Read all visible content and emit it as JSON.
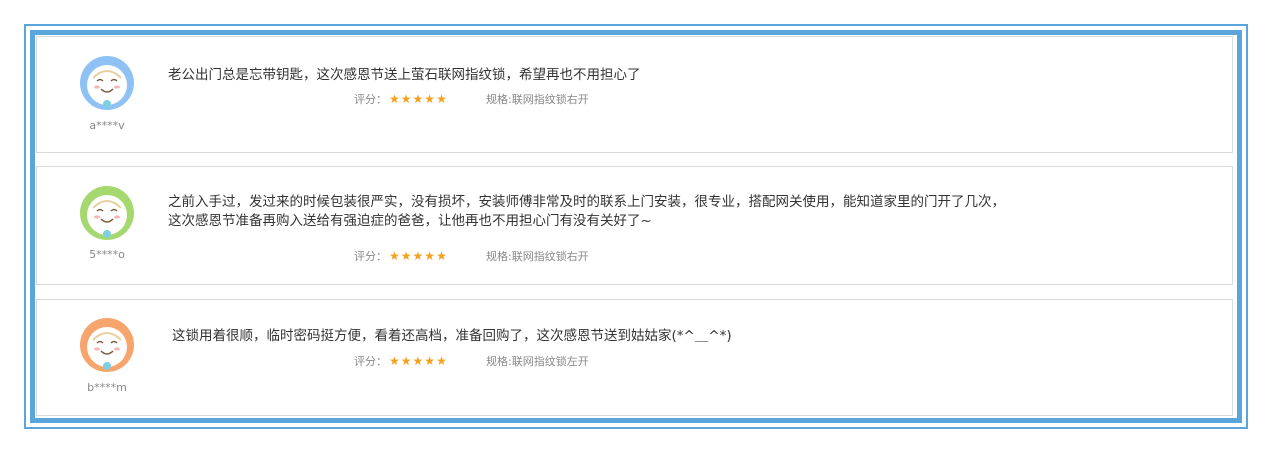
{
  "reviews": [
    {
      "username": "a****v",
      "avatar_color": "#8ec2f5",
      "comment_lines": [
        "老公出门总是忘带钥匙，这次感恩节送上萤石联网指纹锁，希望再也不用担心了"
      ],
      "rating_label": "评分：",
      "rating": 5,
      "spec": "规格:联网指纹锁右开"
    },
    {
      "username": "5****o",
      "avatar_color": "#a5d96f",
      "comment_lines": [
        "之前入手过，发过来的时候包装很严实，没有损坏，安装师傅非常及时的联系上门安装，很专业，搭配网关使用，能知道家里的门开了几次，",
        "这次感恩节准备再购入送给有强迫症的爸爸，让他再也不用担心门有没有关好了~"
      ],
      "rating_label": "评分：",
      "rating": 5,
      "spec": "规格:联网指纹锁右开"
    },
    {
      "username": "b****m",
      "avatar_color": "#f7a56d",
      "comment_lines": [
        "这锁用着很顺，临时密码挺方便，看着还高档，准备回购了，这次感恩节送到姑姑家(*^＿^*)"
      ],
      "rating_label": "评分：",
      "rating": 5,
      "spec": "规格:联网指纹锁左开"
    }
  ],
  "colors": {
    "frame": "#5aa6dc",
    "star": "#f4a11d"
  }
}
